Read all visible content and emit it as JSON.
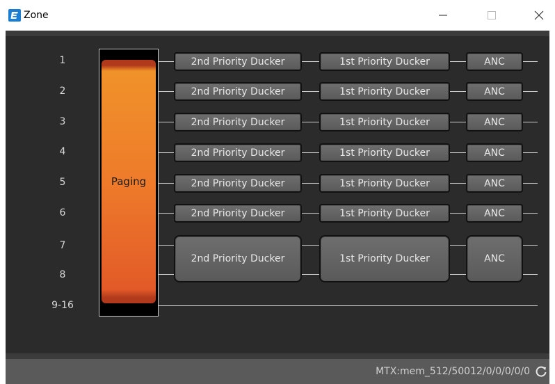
{
  "window": {
    "title": "Zone"
  },
  "channels": [
    "1",
    "2",
    "3",
    "4",
    "5",
    "6",
    "7",
    "8",
    "9-16"
  ],
  "paging": {
    "label": "Paging"
  },
  "rows": [
    {
      "second": "2nd Priority Ducker",
      "first": "1st Priority Ducker",
      "anc": "ANC"
    },
    {
      "second": "2nd Priority Ducker",
      "first": "1st Priority Ducker",
      "anc": "ANC"
    },
    {
      "second": "2nd Priority Ducker",
      "first": "1st Priority Ducker",
      "anc": "ANC"
    },
    {
      "second": "2nd Priority Ducker",
      "first": "1st Priority Ducker",
      "anc": "ANC"
    },
    {
      "second": "2nd Priority Ducker",
      "first": "1st Priority Ducker",
      "anc": "ANC"
    },
    {
      "second": "2nd Priority Ducker",
      "first": "1st Priority Ducker",
      "anc": "ANC"
    },
    {
      "second": "2nd Priority Ducker",
      "first": "1st Priority Ducker",
      "anc": "ANC"
    }
  ],
  "status": {
    "text": "MTX:mem_512/50012/0/0/0/0/0"
  },
  "colors": {
    "paging_orange": "#ee7a2a",
    "panel_bg": "#2b2b2b",
    "accent_blue": "#1a7fd4"
  },
  "icons": {
    "app": "e-logo-icon",
    "refresh": "refresh-icon"
  }
}
